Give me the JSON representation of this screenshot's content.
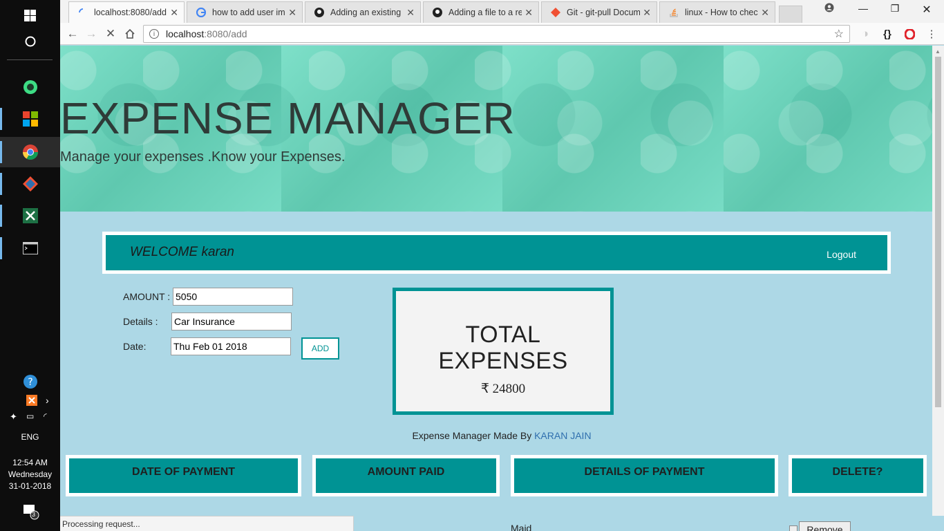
{
  "taskbar": {
    "language": "ENG",
    "clock": {
      "time": "12:54 AM",
      "day": "Wednesday",
      "date": "31-01-2018"
    },
    "notification_count": "3"
  },
  "browser": {
    "tabs": [
      {
        "title": "localhost:8080/add",
        "icon": "loading-spinner-icon",
        "active": true
      },
      {
        "title": "how to add user image",
        "icon": "google-icon",
        "active": false
      },
      {
        "title": "Adding an existing project",
        "icon": "github-icon",
        "active": false
      },
      {
        "title": "Adding a file to a repository",
        "icon": "github-icon",
        "active": false
      },
      {
        "title": "Git - git-pull Documentation",
        "icon": "git-icon",
        "active": false
      },
      {
        "title": "linux - How to check",
        "icon": "stackoverflow-icon",
        "active": false
      }
    ],
    "address": {
      "host": "localhost",
      "path": ":8080/add"
    },
    "status_text": "Processing request..."
  },
  "page": {
    "hero": {
      "title": "EXPENSE MANAGER",
      "tagline": "Manage your expenses .Know your Expenses."
    },
    "welcome_bar": {
      "welcome_text": "WELCOME karan",
      "logout_label": "Logout"
    },
    "form": {
      "amount_label": "AMOUNT :",
      "amount_value": "5050",
      "details_label": "Details :",
      "details_value": "Car Insurance",
      "date_label": "Date:",
      "date_value": "Thu Feb 01 2018",
      "add_label": "ADD"
    },
    "total": {
      "line1": "TOTAL",
      "line2": "EXPENSES",
      "amount": "₹ 24800"
    },
    "credit": {
      "prefix": "Expense Manager Made By ",
      "author": "KARAN JAIN"
    },
    "table_headers": [
      "DATE OF PAYMENT",
      "AMOUNT PAID",
      "DETAILS OF PAYMENT",
      "DELETE?"
    ],
    "first_row": {
      "details": "Maid",
      "remove_label": "Remove"
    }
  },
  "colors": {
    "accent": "#009394",
    "page_bg": "#add8e6",
    "hero_bg": "#6fd3bd"
  }
}
